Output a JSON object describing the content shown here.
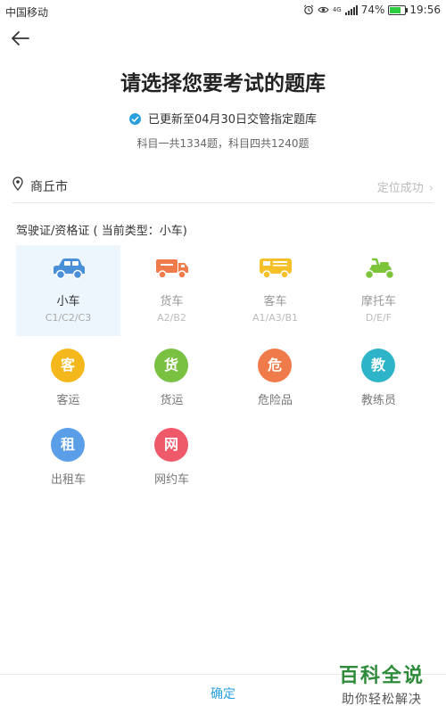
{
  "status_bar": {
    "carrier": "中国移动",
    "network": "4G",
    "battery": "74%",
    "battery_level": 0.74,
    "time": "19:56"
  },
  "header": {
    "title": "请选择您要考试的题库"
  },
  "update": {
    "text": "已更新至04月30日交管指定题库",
    "counts": "科目一共1334题，科目四共1240题"
  },
  "location": {
    "city": "商丘市",
    "status": "定位成功"
  },
  "section": {
    "label": "驾驶证/资格证 ( 当前类型：小车)"
  },
  "vehicles": [
    {
      "name": "小车",
      "code": "C1/C2/C3",
      "selected": true,
      "icon": "car-icon",
      "color": "#4a90d9"
    },
    {
      "name": "货车",
      "code": "A2/B2",
      "selected": false,
      "icon": "truck-icon",
      "color": "#f07b4a"
    },
    {
      "name": "客车",
      "code": "A1/A3/B1",
      "selected": false,
      "icon": "bus-icon",
      "color": "#f5c02a"
    },
    {
      "name": "摩托车",
      "code": "D/E/F",
      "selected": false,
      "icon": "motorcycle-icon",
      "color": "#7cc43a"
    }
  ],
  "qualifications": [
    {
      "char": "客",
      "label": "客运",
      "color": "#f5b81c"
    },
    {
      "char": "货",
      "label": "货运",
      "color": "#7ac142"
    },
    {
      "char": "危",
      "label": "危险品",
      "color": "#f07b4a"
    },
    {
      "char": "教",
      "label": "教练员",
      "color": "#2db4c8"
    },
    {
      "char": "租",
      "label": "出租车",
      "color": "#5a9ee8"
    },
    {
      "char": "网",
      "label": "网约车",
      "color": "#ef5a6a"
    }
  ],
  "footer": {
    "confirm_label": "确定"
  },
  "watermark": {
    "line1": "百科全说",
    "line2": "助你轻松解决"
  }
}
